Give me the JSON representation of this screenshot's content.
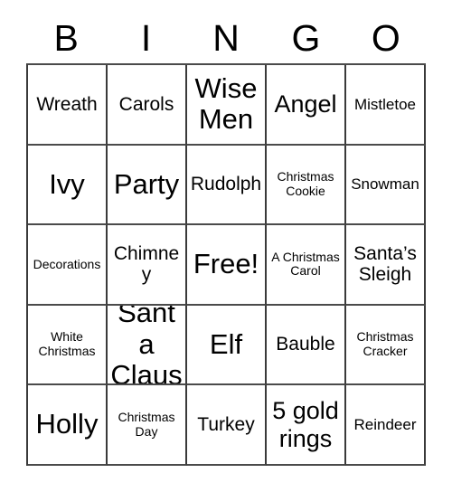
{
  "card": {
    "type": "bingo-card",
    "theme": "Christmas",
    "columns": 5,
    "rows": 5,
    "header": {
      "letters": [
        "B",
        "I",
        "N",
        "G",
        "O"
      ]
    },
    "cells": [
      [
        {
          "text": "Wreath",
          "size": "md"
        },
        {
          "text": "Carols",
          "size": "md"
        },
        {
          "text": "Wise Men",
          "size": "xl"
        },
        {
          "text": "Angel",
          "size": "lg"
        },
        {
          "text": "Mistletoe",
          "size": "sm"
        }
      ],
      [
        {
          "text": "Ivy",
          "size": "xl"
        },
        {
          "text": "Party",
          "size": "xl"
        },
        {
          "text": "Rudolph",
          "size": "md"
        },
        {
          "text": "Christmas Cookie",
          "size": "xs"
        },
        {
          "text": "Snowman",
          "size": "sm"
        }
      ],
      [
        {
          "text": "Decorations",
          "size": "xs"
        },
        {
          "text": "Chimney",
          "size": "md"
        },
        {
          "text": "Free!",
          "size": "xl"
        },
        {
          "text": "A Christmas Carol",
          "size": "xs"
        },
        {
          "text": "Santa’s Sleigh",
          "size": "md"
        }
      ],
      [
        {
          "text": "White Christmas",
          "size": "xs"
        },
        {
          "text": "Santa Claus",
          "size": "xl"
        },
        {
          "text": "Elf",
          "size": "xl"
        },
        {
          "text": "Bauble",
          "size": "md"
        },
        {
          "text": "Christmas Cracker",
          "size": "xs"
        }
      ],
      [
        {
          "text": "Holly",
          "size": "xl"
        },
        {
          "text": "Christmas Day",
          "size": "xs"
        },
        {
          "text": "Turkey",
          "size": "md"
        },
        {
          "text": "5 gold rings",
          "size": "lg"
        },
        {
          "text": "Reindeer",
          "size": "sm"
        }
      ]
    ],
    "free_space": {
      "row": 2,
      "column": 2,
      "label": "Free!"
    },
    "colors": {
      "background": "#ffffff",
      "text": "#000000",
      "grid_line": "#3a3a3a"
    }
  }
}
